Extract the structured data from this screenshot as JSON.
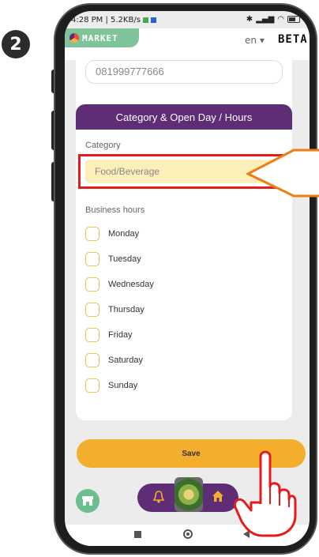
{
  "step": {
    "number": "2"
  },
  "status_bar": {
    "time_speed": "4:28 PM | 5.2KB/s",
    "right_icons": "bluetooth signal wifi battery"
  },
  "app_header": {
    "brand": "MARKET",
    "language": "en",
    "language_caret": "▾",
    "badge": "BETA"
  },
  "contact": {
    "phone_value": "081999777666"
  },
  "section": {
    "title": "Category & Open Day / Hours",
    "category_label": "Category",
    "category_value": "Food/Beverage",
    "hours_label": "Business hours",
    "days": [
      "Monday",
      "Tuesday",
      "Wednesday",
      "Thursday",
      "Friday",
      "Saturday",
      "Sunday"
    ]
  },
  "actions": {
    "save_label": "Save"
  },
  "colors": {
    "purple": "#5e2d75",
    "orange": "#f4ae2d",
    "highlight_red": "#e51c1c",
    "green": "#6bbf8e",
    "input_yellow": "#fcefb9",
    "callout_orange": "#f07d14"
  },
  "icons": [
    "store-icon",
    "bell-icon",
    "food-thumbnail",
    "home-icon",
    "recents-icon",
    "home-circle-icon",
    "back-icon",
    "pointing-hand-icon",
    "callout-arrow"
  ]
}
